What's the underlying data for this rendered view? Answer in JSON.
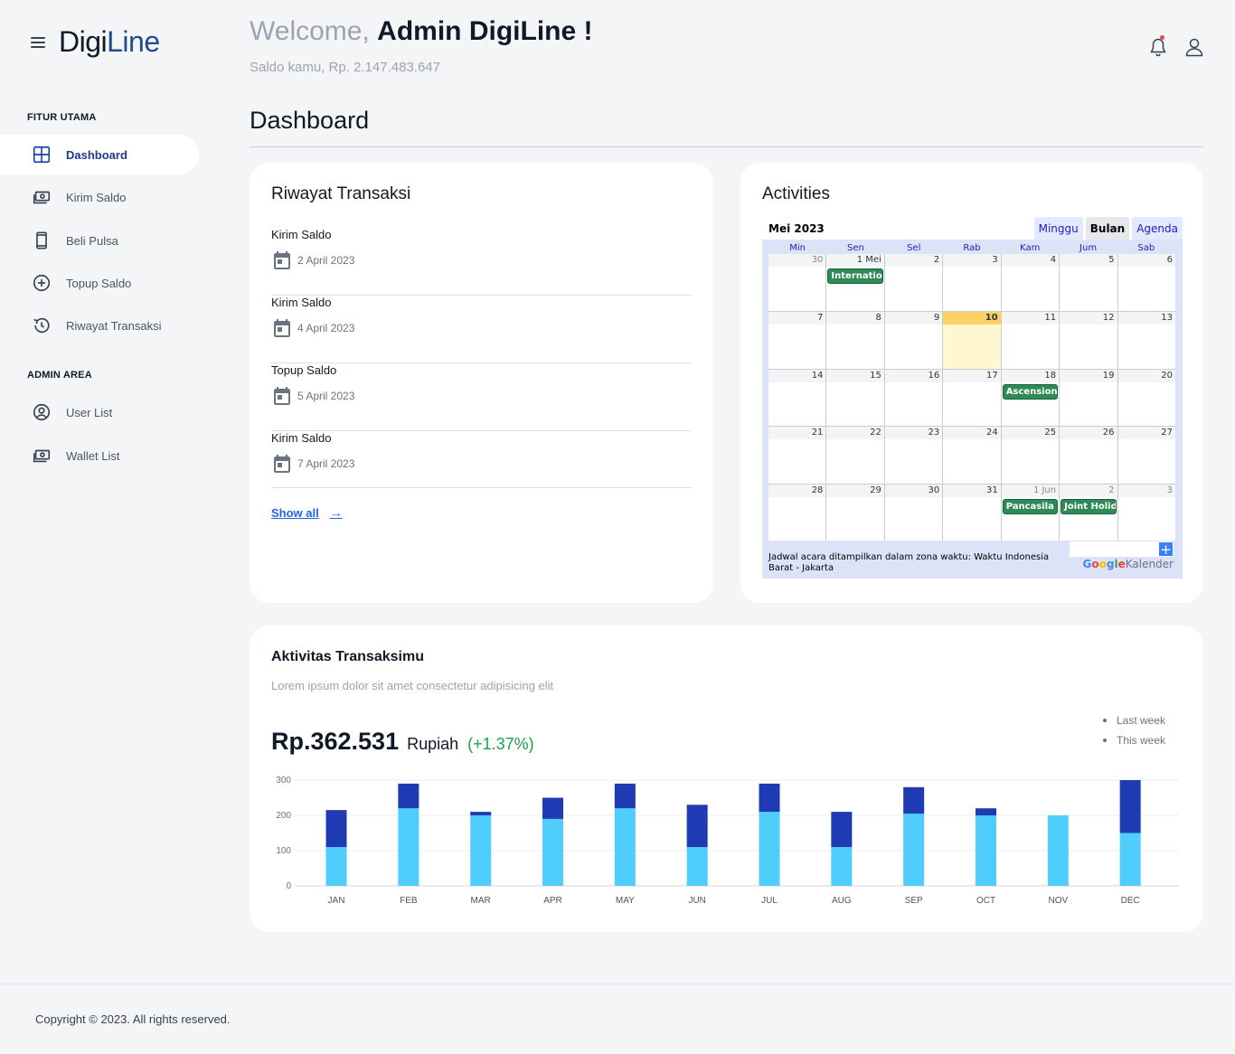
{
  "brand": {
    "part1": "Digi",
    "part2": "Line"
  },
  "sidebar": {
    "sections": [
      {
        "title": "FITUR UTAMA"
      },
      {
        "title": "ADMIN AREA"
      }
    ],
    "items": [
      {
        "label": "Dashboard",
        "icon": "dashboard-grid-icon",
        "active": true
      },
      {
        "label": "Kirim Saldo",
        "icon": "money-icon"
      },
      {
        "label": "Beli Pulsa",
        "icon": "phone-icon"
      },
      {
        "label": "Topup Saldo",
        "icon": "plus-circle-icon"
      },
      {
        "label": "Riwayat Transaksi",
        "icon": "history-icon"
      },
      {
        "label": "User List",
        "icon": "user-circle-icon"
      },
      {
        "label": "Wallet List",
        "icon": "money-icon"
      }
    ]
  },
  "header": {
    "welcome_prefix": "Welcome,",
    "welcome_name": "Admin DigiLine !",
    "saldo": "Saldo kamu, Rp. 2.147.483.647",
    "icons": [
      "bell-icon",
      "user-icon"
    ]
  },
  "page_title": "Dashboard",
  "transactions": {
    "title": "Riwayat Transaksi",
    "items": [
      {
        "name": "Kirim Saldo",
        "date": "2 April 2023"
      },
      {
        "name": "Kirim Saldo",
        "date": "4 April 2023"
      },
      {
        "name": "Topup Saldo",
        "date": "5 April 2023"
      },
      {
        "name": "Kirim Saldo",
        "date": "7 April 2023"
      }
    ],
    "show_all": "Show all",
    "show_all_arrow": "→"
  },
  "activities": {
    "title": "Activities",
    "month_label": "Mei 2023",
    "tabs": [
      "Minggu",
      "Bulan",
      "Agenda"
    ],
    "active_tab": "Bulan",
    "weekdays": [
      "Min",
      "Sen",
      "Sel",
      "Rab",
      "Kam",
      "Jum",
      "Sab"
    ],
    "weeks": [
      [
        {
          "d": "30",
          "o": true
        },
        {
          "d": "1 Mei"
        },
        {
          "d": "2"
        },
        {
          "d": "3"
        },
        {
          "d": "4"
        },
        {
          "d": "5"
        },
        {
          "d": "6"
        }
      ],
      [
        {
          "d": "7"
        },
        {
          "d": "8"
        },
        {
          "d": "9"
        },
        {
          "d": "10",
          "today": true
        },
        {
          "d": "11"
        },
        {
          "d": "12"
        },
        {
          "d": "13"
        }
      ],
      [
        {
          "d": "14"
        },
        {
          "d": "15"
        },
        {
          "d": "16"
        },
        {
          "d": "17"
        },
        {
          "d": "18"
        },
        {
          "d": "19"
        },
        {
          "d": "20"
        }
      ],
      [
        {
          "d": "21"
        },
        {
          "d": "22"
        },
        {
          "d": "23"
        },
        {
          "d": "24"
        },
        {
          "d": "25"
        },
        {
          "d": "26"
        },
        {
          "d": "27"
        }
      ],
      [
        {
          "d": "28"
        },
        {
          "d": "29"
        },
        {
          "d": "30"
        },
        {
          "d": "31"
        },
        {
          "d": "1 Jun",
          "o": true
        },
        {
          "d": "2",
          "o": true
        },
        {
          "d": "3",
          "o": true
        }
      ]
    ],
    "events": [
      {
        "week": 0,
        "day": 1,
        "label": "Internatio"
      },
      {
        "week": 2,
        "day": 4,
        "label": "Ascension"
      },
      {
        "week": 4,
        "day": 4,
        "label": "Pancasila D"
      },
      {
        "week": 4,
        "day": 5,
        "label": "Joint Holid"
      }
    ],
    "timezone_note": "Jadwal acara ditampilkan dalam zona waktu: Waktu Indonesia Barat - Jakarta",
    "logo_google": "Google",
    "logo_kalender": "Kalender",
    "add_label": "+"
  },
  "activity_chart": {
    "title": "Aktivitas Transaksimu",
    "subtitle": "Lorem ipsum dolor sit amet consectetur adipisicing elit",
    "amount": "Rp.362.531",
    "unit": "Rupiah",
    "change": "(+1.37%)",
    "legend": [
      "Last week",
      "This week"
    ]
  },
  "chart_data": {
    "type": "bar",
    "stacked": true,
    "categories": [
      "JAN",
      "FEB",
      "MAR",
      "APR",
      "MAY",
      "JUN",
      "JUL",
      "AUG",
      "SEP",
      "OCT",
      "NOV",
      "DEC"
    ],
    "series": [
      {
        "name": "Last week",
        "color": "#4fcdfc",
        "values": [
          110,
          220,
          200,
          190,
          220,
          110,
          210,
          110,
          205,
          200,
          200,
          150
        ]
      },
      {
        "name": "This week",
        "color": "#1e3bb3",
        "values": [
          105,
          70,
          10,
          60,
          70,
          120,
          80,
          100,
          75,
          20,
          0,
          150
        ]
      }
    ],
    "yticks": [
      0,
      100,
      200,
      300
    ],
    "ylim": [
      0,
      300
    ],
    "grid": true,
    "legend_position": "top-right"
  },
  "footer": {
    "copyright": "Copyright © 2023. All rights reserved."
  }
}
